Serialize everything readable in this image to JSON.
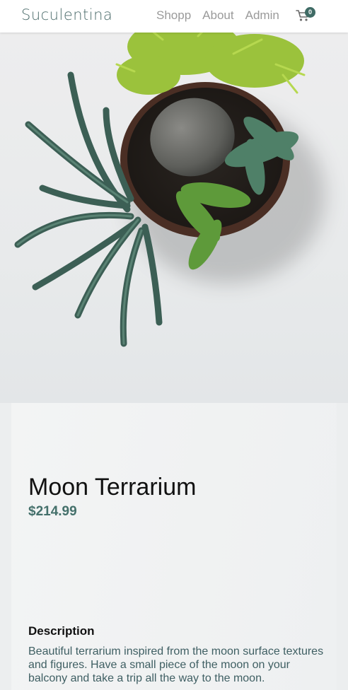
{
  "header": {
    "logo": "Suculentina",
    "nav": [
      "Shopp",
      "About",
      "Admin"
    ],
    "cart_count": "0"
  },
  "product": {
    "title": "Moon Terrarium",
    "price": "$214.99",
    "description_heading": "Description",
    "description": "Beautiful terrarium inspired from the moon surface textures and figures. Have a small piece of the moon on your balcony and take a trip all the way to the moon."
  },
  "colors": {
    "accent": "#44706b",
    "logo": "#4d6d6c",
    "badge": "#3f6b65"
  }
}
